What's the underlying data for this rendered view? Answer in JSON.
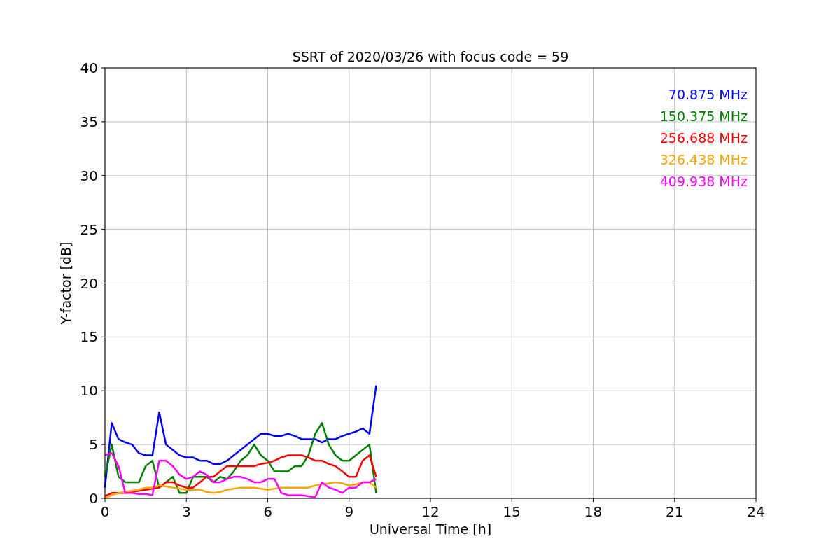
{
  "chart_data": {
    "type": "line",
    "title": "SSRT of 2020/03/26 with focus code = 59",
    "xlabel": "Universal Time [h]",
    "ylabel": "Y-factor [dB]",
    "x": [
      0,
      0.25,
      0.5,
      0.75,
      1,
      1.25,
      1.5,
      1.75,
      2,
      2.25,
      2.5,
      2.75,
      3,
      3.25,
      3.5,
      3.75,
      4,
      4.25,
      4.5,
      4.75,
      5,
      5.25,
      5.5,
      5.75,
      6,
      6.25,
      6.5,
      6.75,
      7,
      7.25,
      7.5,
      7.75,
      8,
      8.25,
      8.5,
      8.75,
      9,
      9.25,
      9.5,
      9.75,
      10
    ],
    "series": [
      {
        "name": "70.875 MHz",
        "color": "#0000ff",
        "values": [
          1,
          7,
          5.5,
          5.2,
          5,
          4.2,
          4,
          4,
          8,
          5,
          4.5,
          4,
          3.8,
          3.8,
          3.5,
          3.5,
          3.2,
          3.2,
          3.5,
          4,
          4.5,
          5,
          5.5,
          6,
          6,
          5.8,
          5.8,
          6,
          5.8,
          5.5,
          5.5,
          5.5,
          5.2,
          5.5,
          5.5,
          5.8,
          6,
          6.2,
          6.5,
          6,
          10.5
        ]
      },
      {
        "name": "150.375 MHz",
        "color": "#008000",
        "values": [
          2,
          5,
          2,
          1.5,
          1.5,
          1.5,
          3,
          3.5,
          1,
          1.5,
          2,
          0.5,
          0.5,
          2,
          2,
          2,
          1.5,
          2,
          1.8,
          2.5,
          3.5,
          4,
          5,
          4,
          3.5,
          2.5,
          2.5,
          2.5,
          3,
          3,
          4,
          6,
          7,
          5,
          4,
          3.5,
          3.5,
          4,
          4.5,
          5,
          0.5
        ]
      },
      {
        "name": "256.688 MHz",
        "color": "#ff0000",
        "values": [
          0.2,
          0.5,
          0.5,
          0.5,
          0.6,
          0.7,
          0.8,
          0.9,
          1,
          1.5,
          1.5,
          1.2,
          1,
          1,
          1.5,
          2,
          2,
          2.5,
          3,
          3,
          3,
          3,
          3,
          3.2,
          3.3,
          3.5,
          3.8,
          4,
          4,
          4,
          3.8,
          3.5,
          3.5,
          3.2,
          3,
          2.5,
          2,
          2,
          3.5,
          4,
          2
        ]
      },
      {
        "name": "326.438 MHz",
        "color": "#ffa500",
        "values": [
          0,
          0.3,
          0.5,
          0.6,
          0.7,
          0.8,
          1,
          1,
          1.2,
          1.1,
          1,
          0.9,
          0.8,
          0.8,
          0.8,
          0.6,
          0.5,
          0.6,
          0.8,
          0.9,
          1,
          1,
          1,
          0.9,
          0.8,
          0.9,
          1,
          1,
          1,
          1,
          1,
          1.2,
          1.3,
          1.4,
          1.5,
          1.4,
          1.2,
          1.3,
          1.5,
          1.5,
          1
        ]
      },
      {
        "name": "409.938 MHz",
        "color": "#ff00ff",
        "values": [
          4,
          4.2,
          3,
          0.5,
          0.5,
          0.4,
          0.4,
          0.3,
          3.5,
          3.5,
          3,
          2.2,
          1.8,
          2,
          2.5,
          2.2,
          1.5,
          1.5,
          1.8,
          2,
          2,
          1.8,
          1.5,
          1.5,
          1.8,
          1.8,
          0.5,
          0.3,
          0.3,
          0.3,
          0.2,
          0.1,
          1.5,
          1,
          0.8,
          0.5,
          1,
          1,
          1.5,
          1.5,
          1.8
        ]
      }
    ],
    "grid": true,
    "xlim": [
      0,
      24
    ],
    "ylim": [
      0,
      40
    ],
    "xticks": [
      0,
      3,
      6,
      9,
      12,
      15,
      18,
      21,
      24
    ],
    "yticks": [
      0,
      5,
      10,
      15,
      20,
      25,
      30,
      35,
      40
    ]
  }
}
